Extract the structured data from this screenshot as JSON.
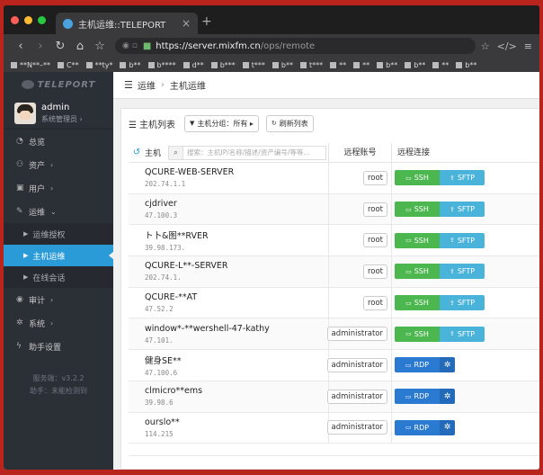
{
  "browser": {
    "tab_title": "主机运维::TELEPORT",
    "tab_close": "×",
    "new_tab": "+",
    "url_host": "https://server.mixfm.cn",
    "url_path": "/ops/remote",
    "bookmarks": [
      "**N**–**",
      "C**",
      "**ty*",
      "b**",
      "b****",
      "d**",
      "b***",
      "t***",
      "b**",
      "t***",
      "**",
      "**",
      "b**",
      "b**",
      "**",
      "b**"
    ]
  },
  "colors": {
    "light_red": "#ff5f57",
    "light_yellow": "#febc2e",
    "light_green": "#28c840"
  },
  "sidebar": {
    "logo": "TELEPORT",
    "user_name": "admin",
    "user_role": "系统管理员 ›",
    "menu": [
      {
        "label": "总览",
        "icon": "dashboard-icon"
      },
      {
        "label": "资产",
        "icon": "assets-icon",
        "chevron": "›"
      },
      {
        "label": "用户",
        "icon": "user-icon",
        "chevron": "›"
      },
      {
        "label": "运维",
        "icon": "wrench-icon",
        "chevron": "⌄"
      }
    ],
    "submenu": [
      "运维授权",
      "主机运维",
      "在线会话"
    ],
    "menu2": [
      {
        "label": "审计",
        "icon": "eye-icon",
        "chevron": "›"
      },
      {
        "label": "系统",
        "icon": "gear-icon",
        "chevron": "›"
      },
      {
        "label": "助手设置",
        "icon": "bolt-icon",
        "chevron": ""
      }
    ],
    "version": "服务端：v3.2.2",
    "helper": "助手：未能检测到"
  },
  "breadcrumb": {
    "root": "运维",
    "current": "主机运维",
    "sep": "›"
  },
  "panel": {
    "title": "主机列表",
    "group_filter": "主机分组：所有 ▸",
    "refresh_list": "刷新列表",
    "col_host": "主机",
    "search_placeholder": "搜索：主机IP/名称/描述/资产编号/等等...",
    "col_account": "远程账号",
    "col_connect": "远程连接",
    "ssh": "SSH",
    "sftp": "SFTP",
    "rdp": "RDP"
  },
  "hosts": [
    {
      "name": "QCURE-WEB-SERVER",
      "ip": "202.74.1.1",
      "account": "root",
      "proto": "ssh"
    },
    {
      "name": "cjdriver",
      "ip": "47.100.3",
      "account": "root",
      "proto": "ssh"
    },
    {
      "name": "ト卜&图**RVER",
      "ip": "39.98.173.",
      "account": "root",
      "proto": "ssh"
    },
    {
      "name": "QCURE-L**-SERVER",
      "ip": "202.74.1.",
      "account": "root",
      "proto": "ssh"
    },
    {
      "name": "QCURE-**AT",
      "ip": "47.52.2",
      "account": "root",
      "proto": "ssh"
    },
    {
      "name": "window*-**wershell-47-kathy",
      "ip": "47.101.",
      "account": "administrator",
      "proto": "ssh"
    },
    {
      "name": "健身SE**",
      "ip": "47.100.6",
      "account": "administrator",
      "proto": "rdp"
    },
    {
      "name": "clmicro**ems",
      "ip": "39.98.6",
      "account": "administrator",
      "proto": "rdp"
    },
    {
      "name": "ourslo**",
      "ip": "114.215",
      "account": "administrator",
      "proto": "rdp"
    }
  ]
}
